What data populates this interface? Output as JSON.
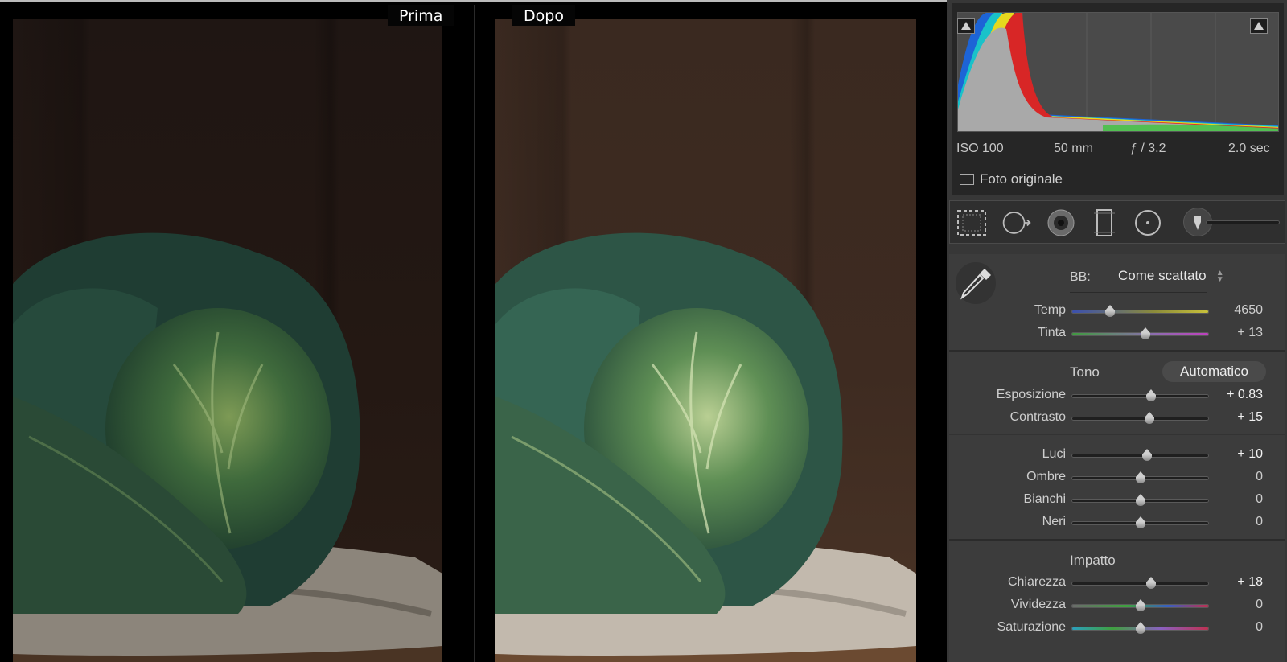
{
  "viewer": {
    "before_label": "Prima",
    "after_label": "Dopo"
  },
  "histogram": {
    "exif": {
      "iso": "ISO 100",
      "focal": "50 mm",
      "aperture": "ƒ / 3.2",
      "shutter": "2.0 sec"
    },
    "original_photo_label": "Foto originale",
    "original_photo_checked": false
  },
  "tools": [
    "crop-overlay-icon",
    "spot-removal-icon",
    "red-eye-icon",
    "graduated-filter-icon",
    "radial-filter-icon",
    "adjustment-brush-icon"
  ],
  "basic": {
    "wb_label": "BB:",
    "wb_value": "Come scattato",
    "tone_title": "Tono",
    "auto_label": "Automatico",
    "presence_title": "Impatto",
    "sliders": {
      "temp": {
        "label": "Temp",
        "value": "4650",
        "position": 0.28
      },
      "tint": {
        "label": "Tinta",
        "value": "+ 13",
        "position": 0.54
      },
      "exposure": {
        "label": "Esposizione",
        "value": "+ 0.83",
        "position": 0.58
      },
      "contrast": {
        "label": "Contrasto",
        "value": "+ 15",
        "position": 0.57
      },
      "highlights": {
        "label": "Luci",
        "value": "+ 10",
        "position": 0.55
      },
      "shadows": {
        "label": "Ombre",
        "value": "0",
        "position": 0.5
      },
      "whites": {
        "label": "Bianchi",
        "value": "0",
        "position": 0.5
      },
      "blacks": {
        "label": "Neri",
        "value": "0",
        "position": 0.5
      },
      "clarity": {
        "label": "Chiarezza",
        "value": "+ 18",
        "position": 0.58
      },
      "vibrance": {
        "label": "Vividezza",
        "value": "0",
        "position": 0.5
      },
      "saturation": {
        "label": "Saturazione",
        "value": "0",
        "position": 0.5
      }
    }
  },
  "colors": {
    "panel": "#373737",
    "section": "#3c3c3c",
    "accent_text": "#f2f2f2"
  }
}
